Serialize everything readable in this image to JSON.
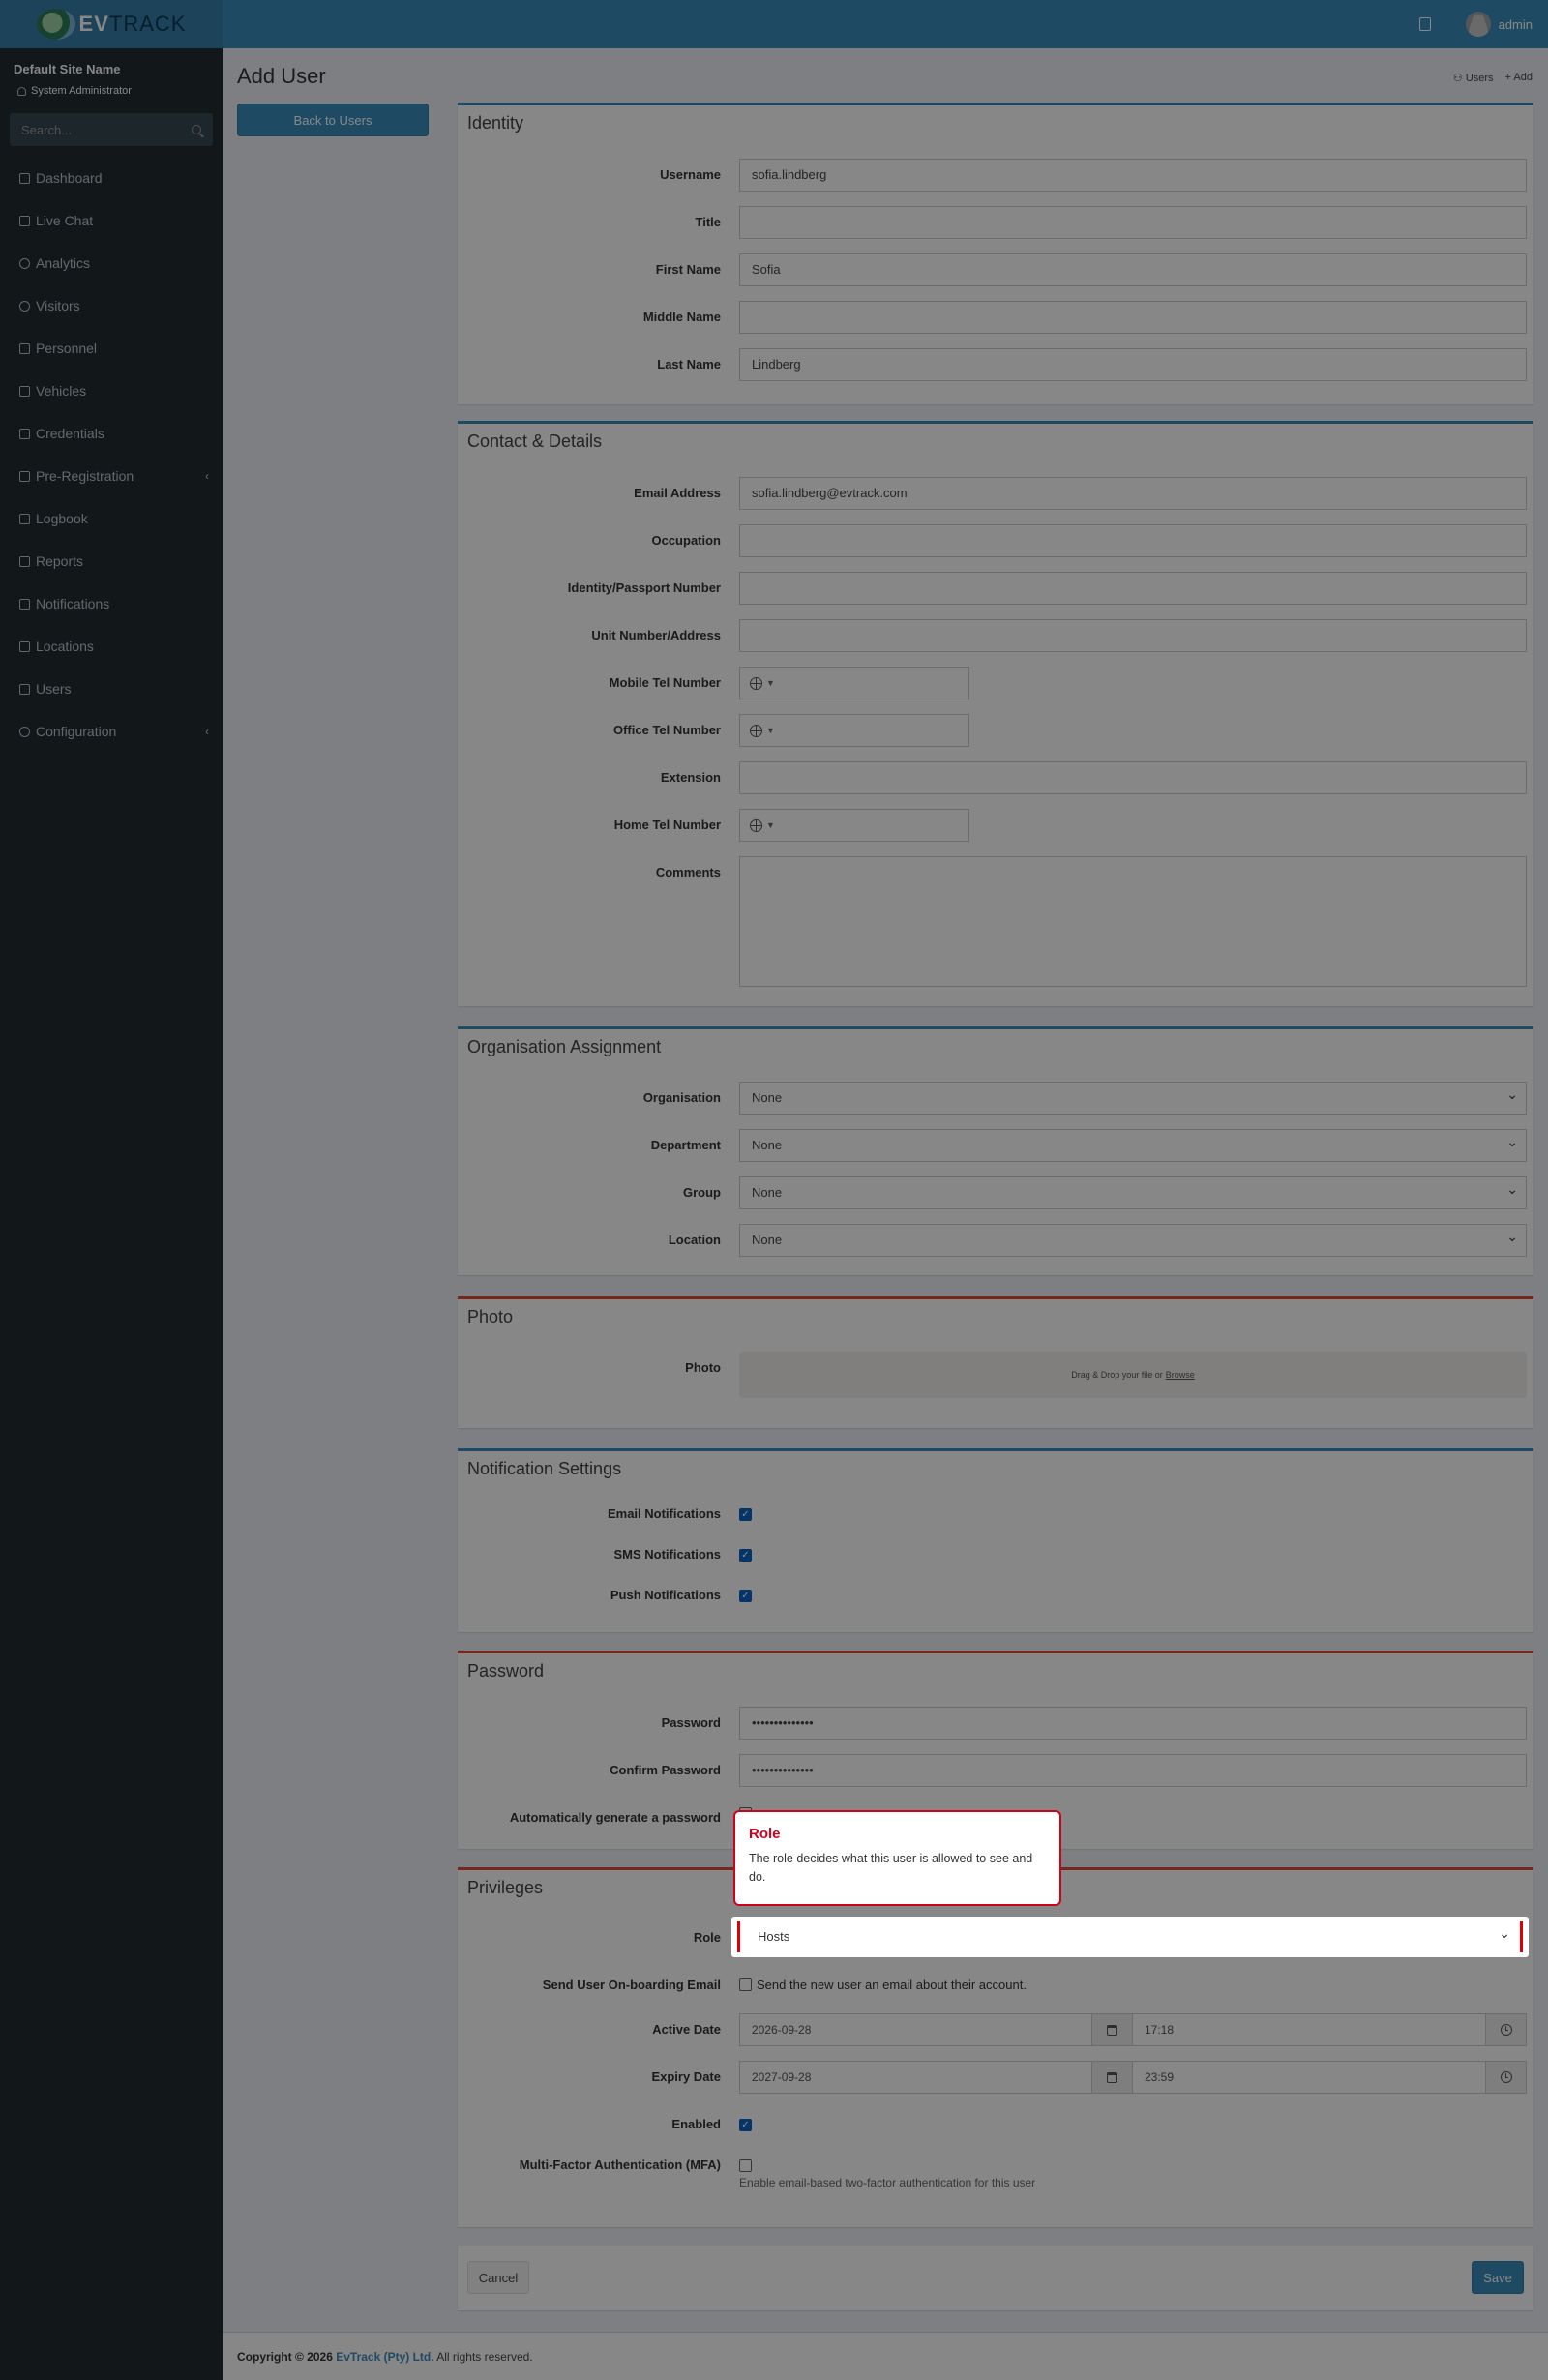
{
  "app": {
    "logo_text_a": "EV",
    "logo_text_b": "TRACK",
    "user_name": "admin"
  },
  "site": {
    "name": "Default Site Name",
    "role": "System Administrator"
  },
  "search": {
    "placeholder": "Search..."
  },
  "nav": {
    "items": [
      {
        "label": "Dashboard"
      },
      {
        "label": "Live Chat"
      },
      {
        "label": "Analytics"
      },
      {
        "label": "Visitors"
      },
      {
        "label": "Personnel"
      },
      {
        "label": "Vehicles"
      },
      {
        "label": "Credentials"
      },
      {
        "label": "Pre-Registration"
      },
      {
        "label": "Logbook"
      },
      {
        "label": "Reports"
      },
      {
        "label": "Notifications"
      },
      {
        "label": "Locations"
      },
      {
        "label": "Users"
      },
      {
        "label": "Configuration"
      }
    ]
  },
  "page": {
    "title": "Add User",
    "crumb_users": "Users",
    "crumb_add": "Add",
    "back_button": "Back to Users"
  },
  "identity": {
    "title": "Identity",
    "username_label": "Username",
    "username": "sofia.lindberg",
    "title_label": "Title",
    "title_value": "",
    "first_name_label": "First Name",
    "first_name": "Sofia",
    "middle_name_label": "Middle Name",
    "middle_name": "",
    "last_name_label": "Last Name",
    "last_name": "Lindberg"
  },
  "contact": {
    "title": "Contact & Details",
    "email_label": "Email Address",
    "email": "sofia.lindberg@evtrack.com",
    "occupation_label": "Occupation",
    "id_label": "Identity/Passport Number",
    "unit_label": "Unit Number/Address",
    "mobile_label": "Mobile Tel Number",
    "office_label": "Office Tel Number",
    "extension_label": "Extension",
    "home_label": "Home Tel Number",
    "comments_label": "Comments"
  },
  "org": {
    "title": "Organisation Assignment",
    "organisation_label": "Organisation",
    "organisation": "None",
    "department_label": "Department",
    "department": "None",
    "group_label": "Group",
    "group": "None",
    "location_label": "Location",
    "location": "None"
  },
  "photo": {
    "title": "Photo",
    "label": "Photo",
    "drop_text": "Drag & Drop your file or",
    "browse": "Browse"
  },
  "notify": {
    "title": "Notification Settings",
    "email_label": "Email Notifications",
    "sms_label": "SMS Notifications",
    "push_label": "Push Notifications"
  },
  "password": {
    "title": "Password",
    "password_label": "Password",
    "password_value": "••••••••••••••",
    "confirm_label": "Confirm Password",
    "confirm_value": "••••••••••••••",
    "auto_label": "Automatically generate a password"
  },
  "privileges": {
    "title": "Privileges",
    "role_label": "Role",
    "role": "Hosts",
    "onboard_label": "Send User On-boarding Email",
    "onboard_text": "Send the new user an email about their account.",
    "active_label": "Active Date",
    "active_date": "2026-09-28",
    "active_time": "17:18",
    "expiry_label": "Expiry Date",
    "expiry_date": "2027-09-28",
    "expiry_time": "23:59",
    "enabled_label": "Enabled",
    "mfa_label": "Multi-Factor Authentication (MFA)",
    "mfa_help": "Enable email-based two-factor authentication for this user"
  },
  "actions": {
    "cancel": "Cancel",
    "save": "Save"
  },
  "tooltip": {
    "title": "Role",
    "body": "The role decides what this user is allowed to see and do."
  },
  "footer": {
    "prefix": "Copyright © 2026",
    "brand": "EvTrack (Pty) Ltd.",
    "suffix": "All rights reserved."
  }
}
